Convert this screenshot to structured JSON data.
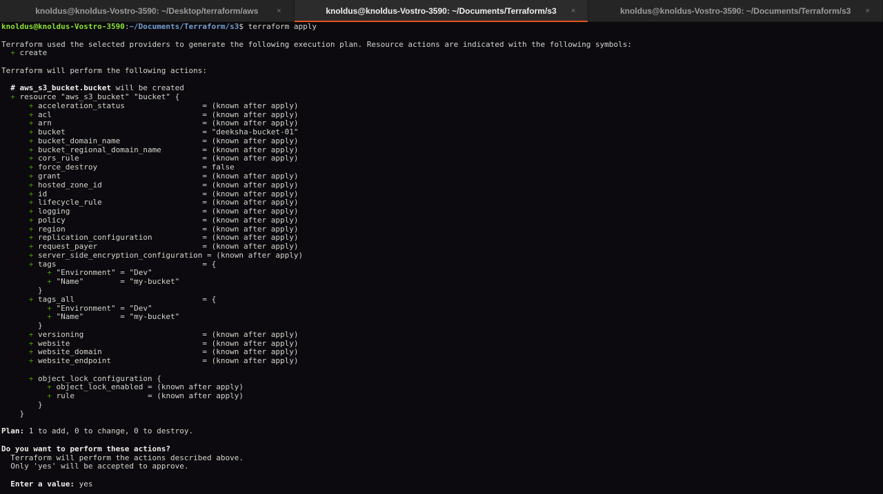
{
  "tabs": [
    {
      "label": "knoldus@knoldus-Vostro-3590: ~/Desktop/terraform/aws",
      "close": "×",
      "active": false
    },
    {
      "label": "knoldus@knoldus-Vostro-3590: ~/Documents/Terraform/s3",
      "close": "×",
      "active": true
    },
    {
      "label": "knoldus@knoldus-Vostro-3590: ~/Documents/Terraform/s3",
      "close": "×",
      "active": false
    }
  ],
  "terminal": {
    "prompt": {
      "user_host": "knoldus@knoldus-Vostro-3590",
      "sep": ":",
      "path": "~/Documents/Terraform/s3",
      "dollar": "$ ",
      "command": "terraform apply"
    },
    "intro": "Terraform used the selected providers to generate the following execution plan. Resource actions are indicated with the following symbols:",
    "create_symbol": "+",
    "create_word": " create",
    "will_perform": "Terraform will perform the following actions:",
    "resource_comment_hash": "# ",
    "resource_name": "aws_s3_bucket.bucket",
    "resource_comment_rest": " will be created",
    "resource_decl": " resource \"aws_s3_bucket\" \"bucket\" {",
    "attrs": [
      {
        "key": "acceleration_status",
        "value": "(known after apply)"
      },
      {
        "key": "acl",
        "value": "(known after apply)"
      },
      {
        "key": "arn",
        "value": "(known after apply)"
      },
      {
        "key": "bucket",
        "value": "\"deeksha-bucket-01\""
      },
      {
        "key": "bucket_domain_name",
        "value": "(known after apply)"
      },
      {
        "key": "bucket_regional_domain_name",
        "value": "(known after apply)"
      },
      {
        "key": "cors_rule",
        "value": "(known after apply)"
      },
      {
        "key": "force_destroy",
        "value": "false"
      },
      {
        "key": "grant",
        "value": "(known after apply)"
      },
      {
        "key": "hosted_zone_id",
        "value": "(known after apply)"
      },
      {
        "key": "id",
        "value": "(known after apply)"
      },
      {
        "key": "lifecycle_rule",
        "value": "(known after apply)"
      },
      {
        "key": "logging",
        "value": "(known after apply)"
      },
      {
        "key": "policy",
        "value": "(known after apply)"
      },
      {
        "key": "region",
        "value": "(known after apply)"
      },
      {
        "key": "replication_configuration",
        "value": "(known after apply)"
      },
      {
        "key": "request_payer",
        "value": "(known after apply)"
      },
      {
        "key": "server_side_encryption_configuration",
        "value": "(known after apply)"
      }
    ],
    "tags": {
      "key": "tags",
      "open": "{",
      "entries": [
        {
          "key": "\"Environment\"",
          "value": "\"Dev\""
        },
        {
          "key": "\"Name\"       ",
          "value": "\"my-bucket\""
        }
      ],
      "close": "}"
    },
    "tags_all": {
      "key": "tags_all",
      "open": "{",
      "entries": [
        {
          "key": "\"Environment\"",
          "value": "\"Dev\""
        },
        {
          "key": "\"Name\"       ",
          "value": "\"my-bucket\""
        }
      ],
      "close": "}"
    },
    "attrs2": [
      {
        "key": "versioning",
        "value": "(known after apply)"
      },
      {
        "key": "website",
        "value": "(known after apply)"
      },
      {
        "key": "website_domain",
        "value": "(known after apply)"
      },
      {
        "key": "website_endpoint",
        "value": "(known after apply)"
      }
    ],
    "lock_block": {
      "key": "object_lock_configuration",
      "open": " {",
      "entries": [
        {
          "key": "object_lock_enabled",
          "value": "(known after apply)"
        },
        {
          "key": "rule               ",
          "value": "(known after apply)"
        }
      ],
      "close": "}"
    },
    "resource_close": "}",
    "plan_label": "Plan:",
    "plan_text": " 1 to add, 0 to change, 0 to destroy.",
    "question": "Do you want to perform these actions?",
    "question_line1": "  Terraform will perform the actions described above.",
    "question_line2": "  Only 'yes' will be accepted to approve.",
    "enter_label": "Enter a value:",
    "enter_value": " yes"
  }
}
